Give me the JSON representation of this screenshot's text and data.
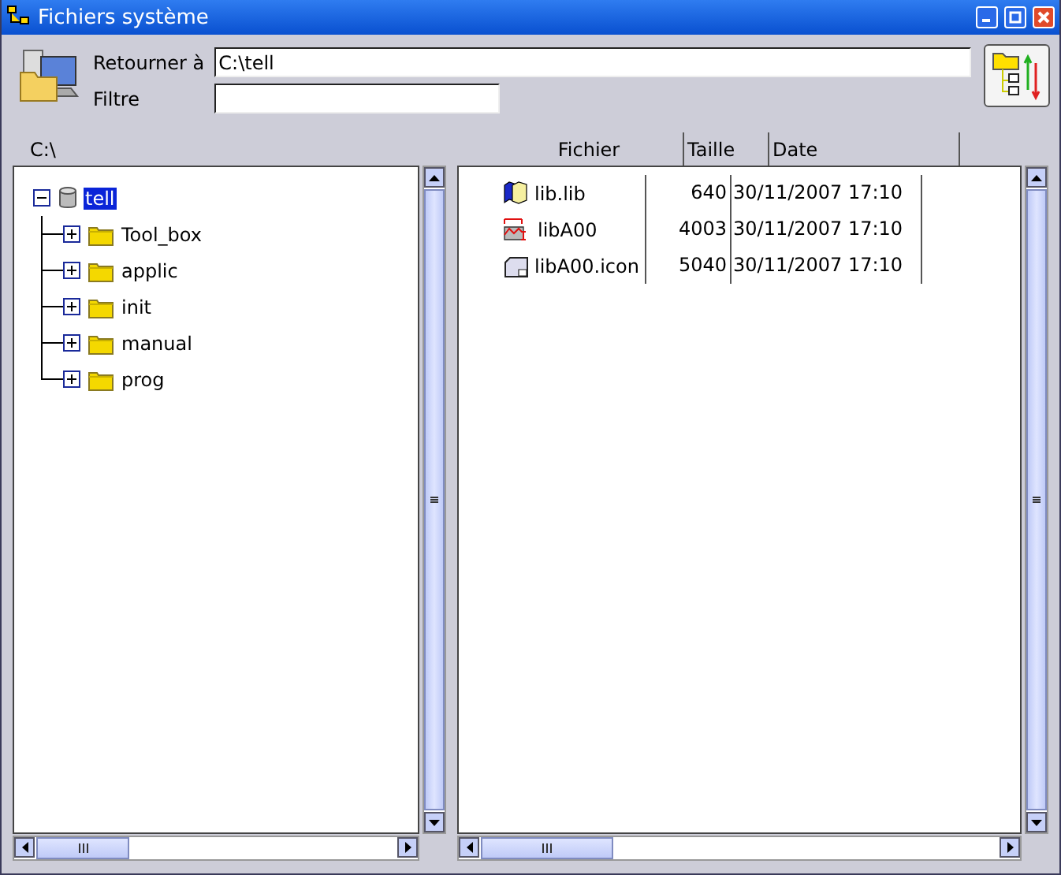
{
  "window": {
    "title": "Fichiers système"
  },
  "form": {
    "back_label": "Retourner à",
    "back_value": "C:\\tell",
    "filter_label": "Filtre"
  },
  "path": "C:\\",
  "tree": [
    {
      "label": "tell",
      "selected": true,
      "expanded": true,
      "children": [
        {
          "label": "Tool_box",
          "selected": false,
          "expanded": false
        },
        {
          "label": "applic",
          "selected": false,
          "expanded": false
        },
        {
          "label": "init",
          "selected": false,
          "expanded": false
        },
        {
          "label": "manual",
          "selected": false,
          "expanded": false
        },
        {
          "label": "prog",
          "selected": false,
          "expanded": false
        }
      ]
    }
  ],
  "files": {
    "columns": [
      "Fichier",
      "Taille",
      "Date"
    ],
    "rows": [
      {
        "kind": "book",
        "name": "lib.lib",
        "size": "640",
        "date": "30/11/2007 17:10"
      },
      {
        "kind": "chart",
        "name": "libA00",
        "size": "4003",
        "date": "30/11/2007 17:10"
      },
      {
        "kind": "document",
        "name": "libA00.icon",
        "size": "5040",
        "date": "30/11/2007 17:10"
      }
    ]
  }
}
